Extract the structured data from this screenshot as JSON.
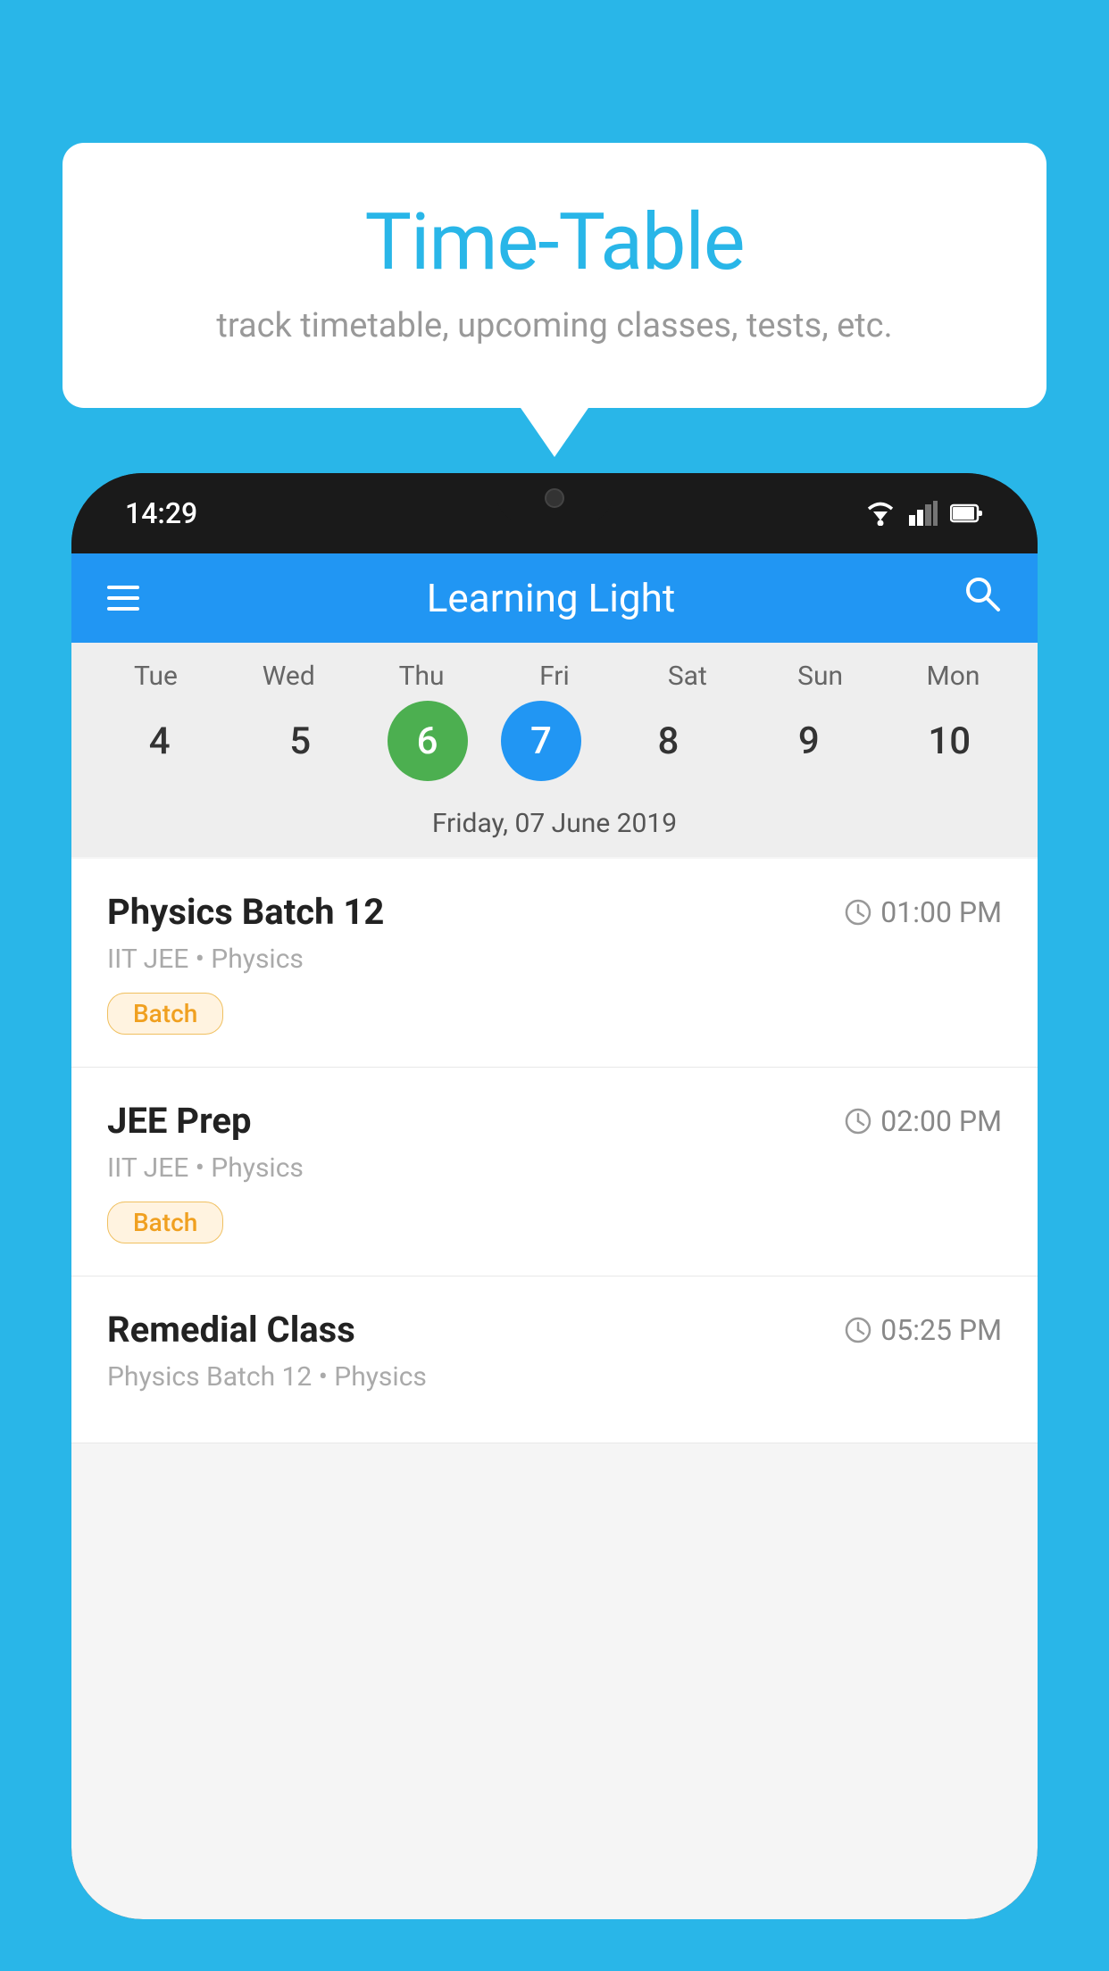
{
  "background_color": "#29b6e8",
  "bubble": {
    "title": "Time-Table",
    "subtitle": "track timetable, upcoming classes, tests, etc."
  },
  "phone": {
    "status_time": "14:29",
    "app_name": "Learning Light",
    "selected_date_label": "Friday, 07 June 2019",
    "days": [
      {
        "label": "Tue",
        "num": "4"
      },
      {
        "label": "Wed",
        "num": "5"
      },
      {
        "label": "Thu",
        "num": "6",
        "state": "today"
      },
      {
        "label": "Fri",
        "num": "7",
        "state": "selected"
      },
      {
        "label": "Sat",
        "num": "8"
      },
      {
        "label": "Sun",
        "num": "9"
      },
      {
        "label": "Mon",
        "num": "10"
      }
    ],
    "classes": [
      {
        "name": "Physics Batch 12",
        "time": "01:00 PM",
        "meta": "IIT JEE • Physics",
        "badge": "Batch"
      },
      {
        "name": "JEE Prep",
        "time": "02:00 PM",
        "meta": "IIT JEE • Physics",
        "badge": "Batch"
      },
      {
        "name": "Remedial Class",
        "time": "05:25 PM",
        "meta": "Physics Batch 12 • Physics",
        "badge": null
      }
    ]
  }
}
